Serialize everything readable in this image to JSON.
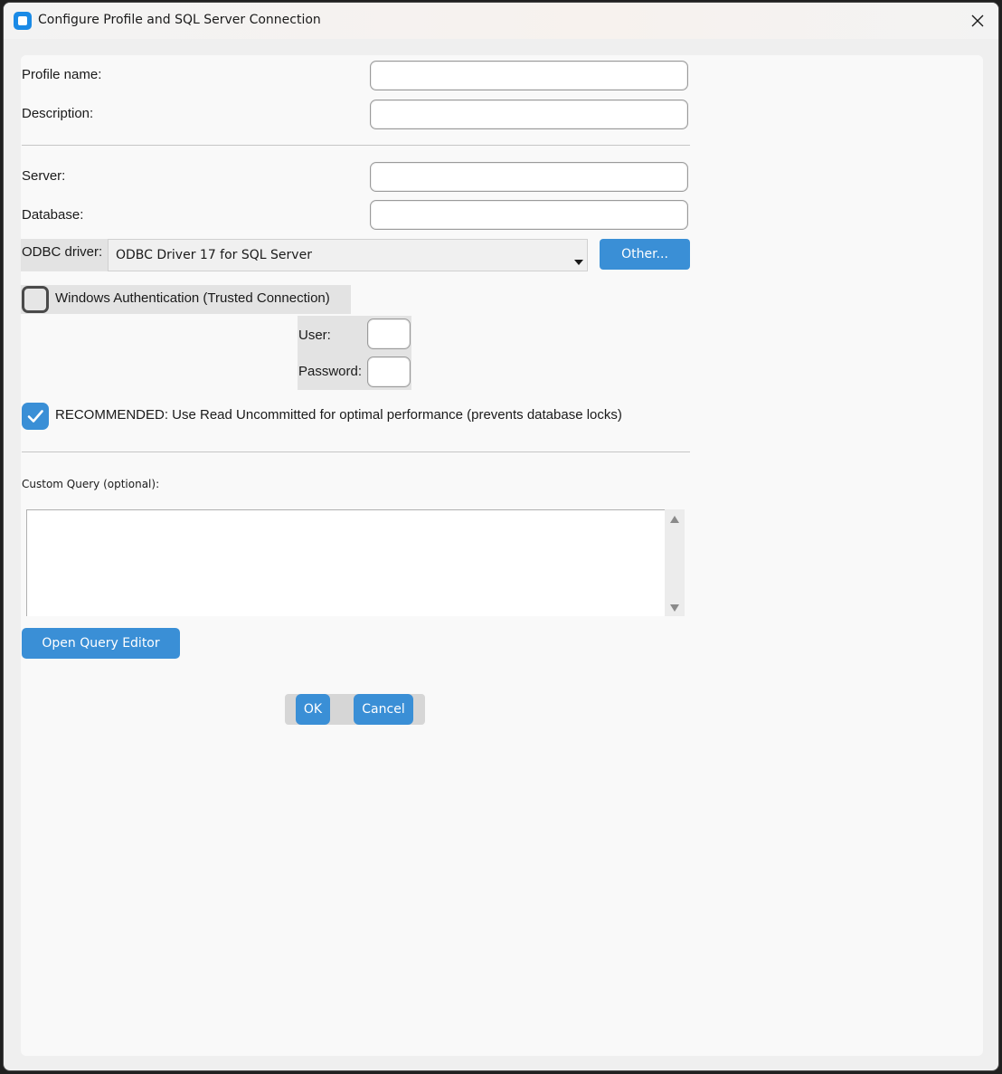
{
  "window": {
    "title": "Configure Profile and SQL Server Connection"
  },
  "form": {
    "profile_name_label": "Profile name:",
    "profile_name_value": "",
    "description_label": "Description:",
    "description_value": "",
    "server_label": "Server:",
    "server_value": "",
    "database_label": "Database:",
    "database_value": "",
    "odbc_label": "ODBC driver:",
    "odbc_selected": "ODBC Driver 17 for SQL Server",
    "other_button": "Other...",
    "windows_auth_label": "Windows Authentication (Trusted Connection)",
    "windows_auth_checked": false,
    "user_label": "User:",
    "user_value": "",
    "password_label": "Password:",
    "password_value": "",
    "read_uncommitted_label": "RECOMMENDED: Use Read Uncommitted for optimal performance (prevents database locks)",
    "read_uncommitted_checked": true,
    "custom_query_label": "Custom Query (optional):",
    "custom_query_value": "",
    "open_query_editor_button": "Open Query Editor",
    "ok_button": "OK",
    "cancel_button": "Cancel"
  },
  "colors": {
    "accent": "#3a8fd6",
    "background": "#f9f9f9",
    "titlebar": "#f3f3f3"
  },
  "icons": {
    "app": "app-window-icon",
    "close": "close-icon",
    "dropdown": "chevron-down-icon",
    "check": "checkmark-icon"
  }
}
